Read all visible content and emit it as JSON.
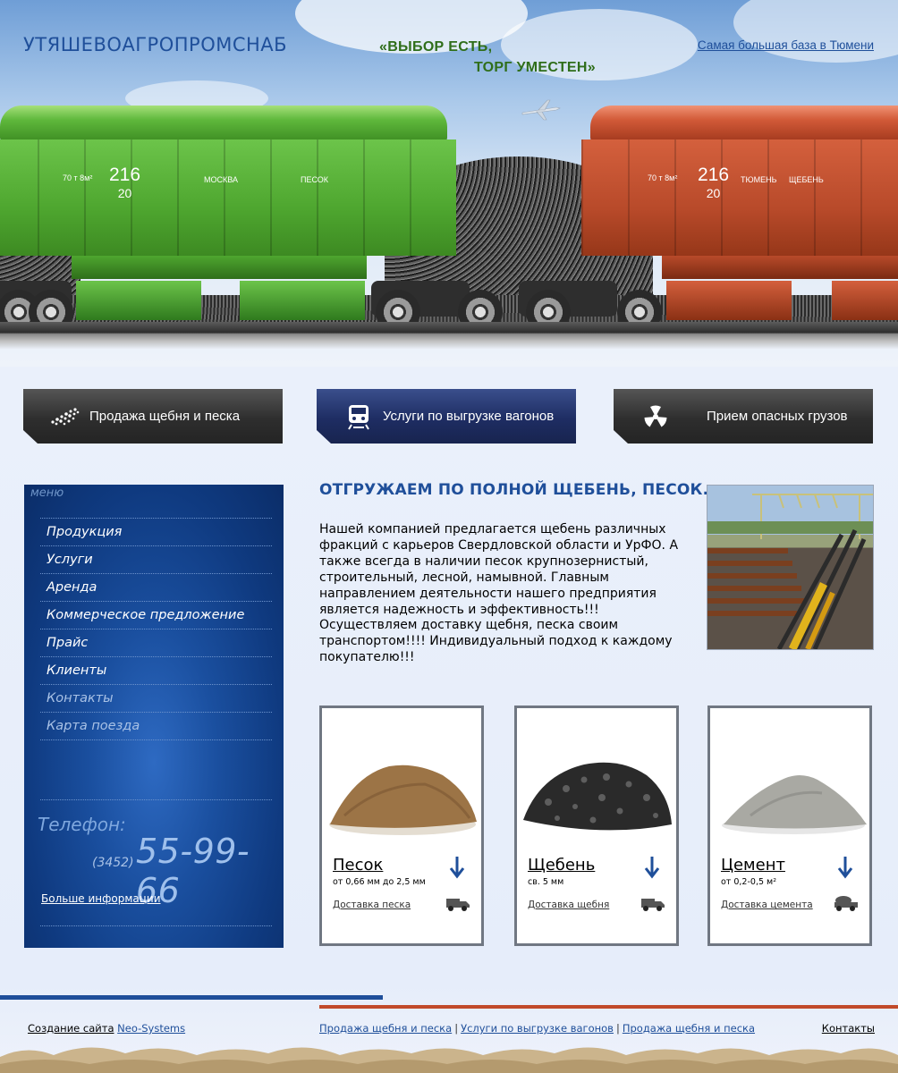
{
  "header": {
    "logo": "УТЯШЕВОАГРОПРОМСНАБ",
    "slogan_line1": "«ВЫБОР ЕСТЬ,",
    "slogan_line2": "ТОРГ УМЕСТЕН»",
    "top_link": "Самая большая база в Тюмени"
  },
  "wagons": {
    "green": {
      "capacity": "70 т 8м²",
      "number": "216",
      "sub": "20",
      "city": "МОСКВА",
      "cargo": "ПЕСОК"
    },
    "red": {
      "capacity": "70 т 8м²",
      "number": "216",
      "sub": "20",
      "city": "ТЮМЕНЬ",
      "cargo": "ЩЕБЕНЬ"
    }
  },
  "features": [
    {
      "label": "Продажа щебня и песка",
      "icon": "gravel-icon"
    },
    {
      "label": "Услуги по выгрузке вагонов",
      "icon": "train-icon"
    },
    {
      "label": "Прием опасных грузов",
      "icon": "radiation-icon"
    }
  ],
  "sidebar": {
    "title": "меню",
    "items": [
      {
        "label": "Продукция"
      },
      {
        "label": "Услуги"
      },
      {
        "label": "Аренда"
      },
      {
        "label": "Коммерческое предложение"
      },
      {
        "label": "Прайс"
      },
      {
        "label": "Клиенты"
      },
      {
        "label": "Контакты"
      },
      {
        "label": "Карта поезда"
      }
    ],
    "phone_label": "Телефон:",
    "phone_code": "(3452)",
    "phone_number": "55-99-66",
    "more_link": "Больше информации"
  },
  "main": {
    "title": "ОТГРУЖАЕМ ПО ПОЛНОЙ ЩЕБЕНЬ, ПЕСОК.",
    "intro": "Нашей компанией предлагается щебень различных фракций с карьеров Свердловской области и УрФО. А также всегда в наличии песок крупнозернистый, строительный, лесной, намывной. Главным направлением деятельности нашего предприятия является надежность и эффективность!!! Осуществляем доставку щебня, песка своим транспортом!!!! Индивидуальный подход к каждому покупателю!!!"
  },
  "products": [
    {
      "name": "Песок",
      "desc": "от 0,66 мм до 2,5 мм",
      "link": "Доставка песка"
    },
    {
      "name": "Щебень",
      "desc": "св. 5 мм",
      "link": "Доставка щебня"
    },
    {
      "name": "Цемент",
      "desc": "от 0,2-0,5 м²",
      "link": "Доставка цемента"
    }
  ],
  "footer": {
    "credit_prefix": "Создание сайта",
    "credit_link": "Neo-Systems",
    "nav": [
      "Продажа щебня и песка",
      "Услуги по выгрузке вагонов",
      "Продажа щебня и песка"
    ],
    "contacts": "Контакты"
  },
  "colors": {
    "brand_blue": "#1f4f9a",
    "slogan_green": "#2f6e1a",
    "accent_red": "#c14a2a",
    "sidebar_blue": "#1a4f9f"
  }
}
